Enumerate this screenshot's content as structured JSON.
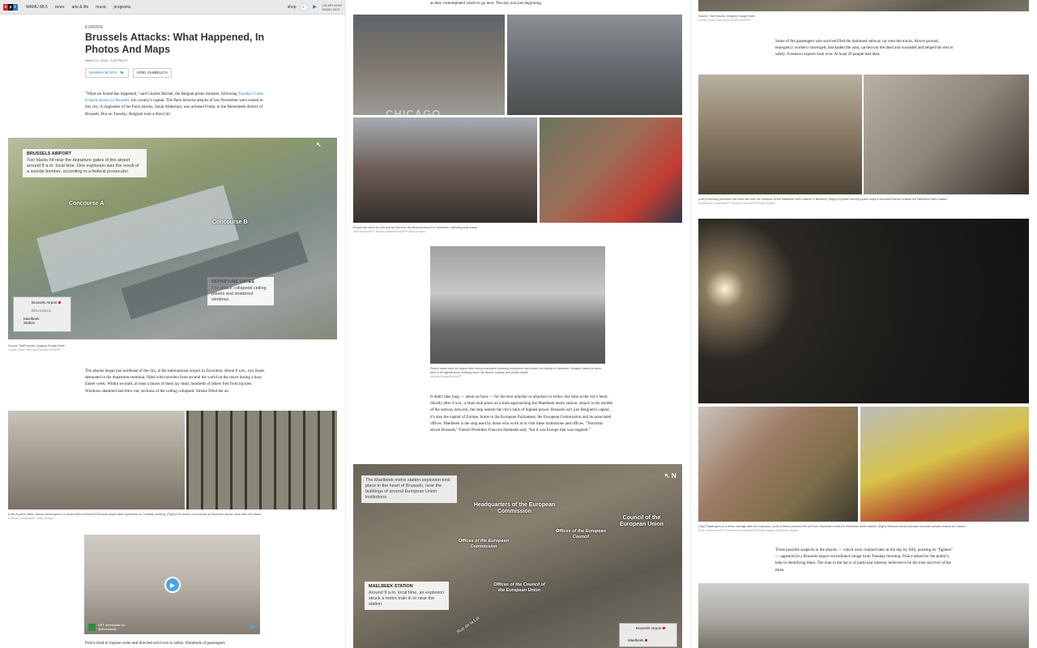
{
  "nav": {
    "logo": [
      "n",
      "p",
      "r"
    ],
    "links": [
      "WAMU 88.5",
      "news",
      "arts & life",
      "music",
      "programs"
    ],
    "shop_label": "shop",
    "on_air_label": "ON AIR NOW",
    "station": "WAMU 88.5"
  },
  "article": {
    "section": "EUROPE",
    "title": "Brussels Attacks: What Happened, In Photos And Maps",
    "date": "March 22, 2016 · 5:25 PM ET",
    "authors": [
      "HANNAH BLOCH",
      "ARIEL ZAMBELICH"
    ],
    "intro": {
      "part1": "\"What we feared has happened,\" said Charles Michel, the Belgian prime minister, following ",
      "link": "Tuesday's back-to-back attacks in Brussels",
      "part2": ", his country's capital. The Paris terrorist attacks of last November were rooted in this city. A ringleader of the Paris attacks, Salah Abdeslam, was arrested Friday in the Molenbeek district of Brussels. But on Tuesday, Belgium took a direct hit."
    },
    "airport_map": {
      "callout_title": "BRUSSELS AIRPORT",
      "callout_text": "Two blasts hit near the departure gates of the airport around 8 a.m. local time. One explosion was the result of a suicide bomber, according to a federal prosecutor.",
      "label_a": "Concourse A",
      "label_b": "Concourse B",
      "gates_title": "DEPARTURE GATES",
      "gates_text": "The attack collapsed ceiling panels and shattered windows.",
      "mini_airport": "Brussels Airport",
      "mini_city": "BRUSSELS",
      "mini_station": "Maelbeek Station",
      "caption": "Source: Staff reports; Imagery Google Earth",
      "credit": "Credit: Sonia Park and Richard Hoi/NPR"
    },
    "para2": "The attacks began just northeast of the city, at the international airport in Zaventem. About 8 a.m., two blasts detonated in the departures terminal, filled with travelers from around the world on the move during a busy Easter week. Within seconds, at least a dozen of them lay dead; hundreds of others fled from injuries. Windows shattered and blew out; sections of the ceiling collapsed. Smoke filled the air.",
    "caption2": "(Left) A police officer directs passengers in a smoke-filled terminal at Brussels airport after explosions on Tuesday morning. (Right) The blown-out windows at Zaventem airport, seen after the attack.",
    "credit2": "Ketevan Kardava/AP; Getty Images",
    "video_source": "VRT deredactie.be",
    "video_handle": "@deredactie",
    "para3": "Police tried to impose order and directed survivors to safety. Hundreds of passengers",
    "col2_top": "as they contemplated where to go next. The day was just beginning.",
    "shirt_text": "CHICAGO",
    "caption3": "People are taken by foot and by bus from the Brussels airport in Zaventem, following dual blasts.",
    "credit3": "Dirk Waem/AFP; Nicolas Maeterlinck/AFP/Getty Images",
    "caption4": "People stand near the airport after being evacuated following explosions that rocked the facility in Zaventem. Belgium raised its terror alert to its highest level, shutting down the airport, subway and public transit.",
    "credit4": "Nicolas Maeterlinck/AFP",
    "para4": "It didn't take long — about an hour — for the next attacker or attackers to strike, this time at the city's heart. Shortly after 9 a.m., a blast took place on a train approaching the Maelbeek metro station, smack in the middle of the subway network, the stop nearest the city's halls of highest power. Brussels isn't just Belgium's capital, it's also the capital of Europe, home to the European Parliament, the European Commission and its associated offices. Maelbeek is the stop used by those who work at or visit these institutions and offices. \"Terrorists struck Brussels,\" French President Francois Hollande said, \"but it was Europe that was targeted.\"",
    "metro_map": {
      "info_text": "The Maelbeek metro station explosion took place in the heart of Brussels, near the buildings of several European Union institutions.",
      "hq_label": "Headquarters of the European Commission",
      "council_label": "Council of the European Union",
      "offices_commission": "Offices of the European Commission",
      "offices_council": "Offices of the European Council",
      "offices_council_eu": "Offices of the Council of the European Union",
      "station_title": "MAELBEEK STATION",
      "station_text": "Around 9 a.m. local time, an explosion struck a metro train in or near the station.",
      "street": "Rue de la Loi",
      "mini_airport": "Brussels Airport",
      "mini_station": "Maelbeek"
    },
    "col3_caption_top": "Source: Staff reports; Imagery Google Earth",
    "col3_credit_top": "Credit: Sonia Park and Richard Hoi/NPR",
    "para5": "Some of the passengers who survived fled the darkened subway car onto the tracks. Above ground, emergency workers converged, blockaded the area, carried out the dead and wounded and helped the rest to safety. Forensics experts took over. At least 20 people had died.",
    "caption5": "(Left) A security perimeter has been set near the entrance to the Maelbeek metro station in Brussels. (Right) A private security guard helps a wounded woman outside the Maelbeek metro station.",
    "credit5": "Emmanuel Dunand/AFP; Michael Hirsch/AFP/Getty Images",
    "caption6": "(Top) Passengers in a metro carriage after the explosion. (Left) A victim receives first aid from responders near the Maelbeek metro station. (Right) Rescue teams evacuate wounded people outside the station.",
    "credit6": "Evan Lamos via AP; Emmanuel Dunand/AFP/Getty Images; AP/Getty Images",
    "para6": "Three possible suspects in the attacks — which were claimed later in the day by ISIS, praising its \"fighters\" — appeared in a Brussels airport surveillance image from Tuesday morning. Police asked for the public's help in identifying them. The man in the hat is of particular interest, believed to be the lone survivor of the three."
  }
}
